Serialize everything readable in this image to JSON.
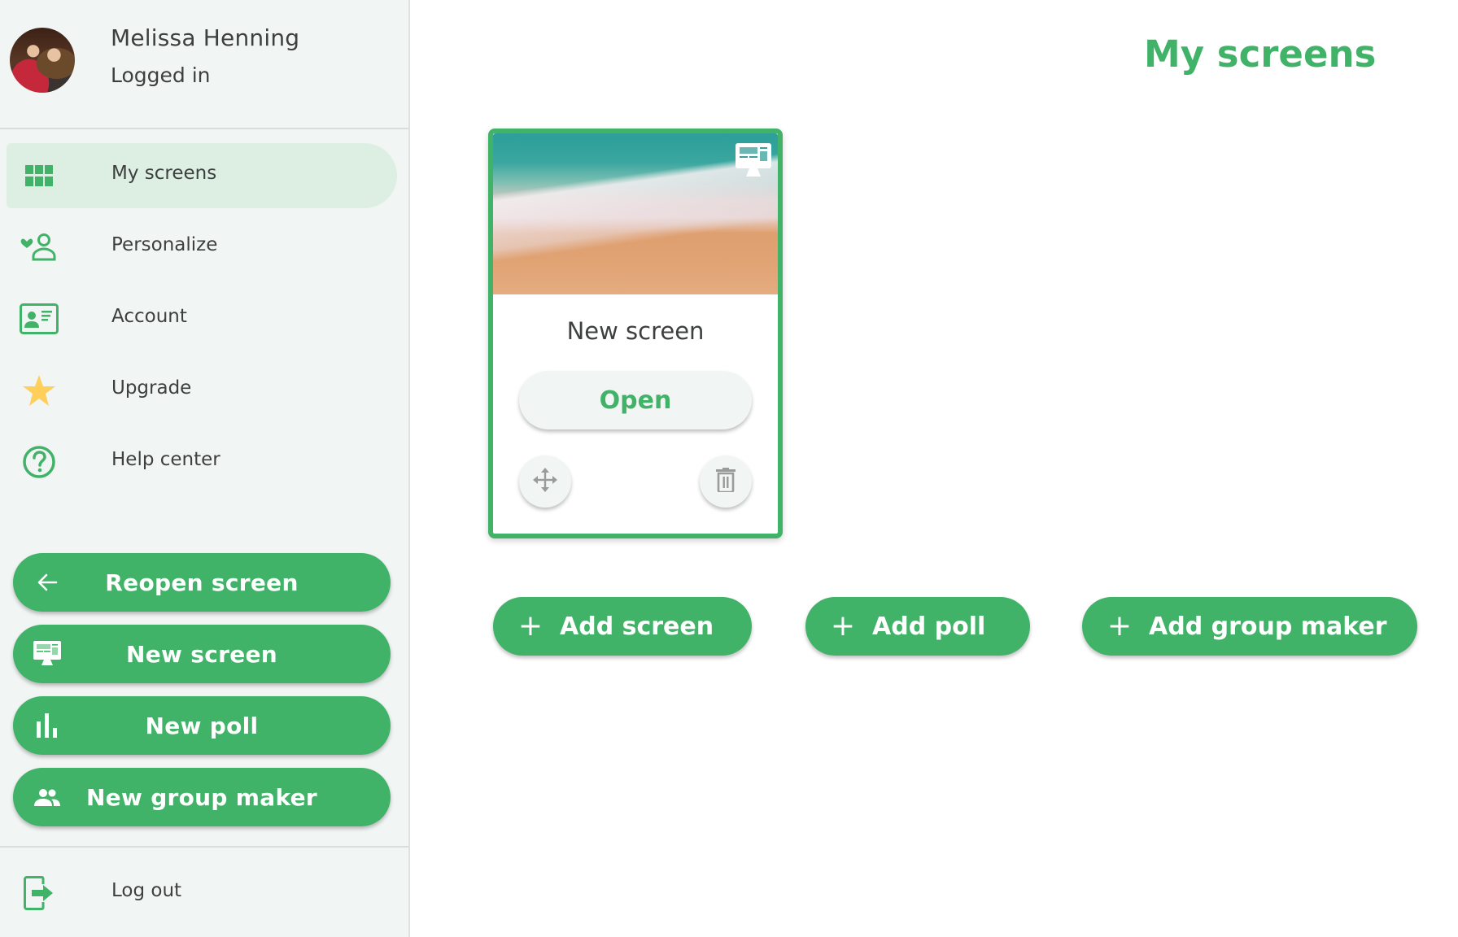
{
  "colors": {
    "accent": "#41b368",
    "sidebar_bg": "#f1f5f4",
    "active_item_bg": "#ddefe3",
    "star": "#ffcf5c",
    "icon_gray": "#9a9a9a"
  },
  "user": {
    "name": "Melissa Henning",
    "status": "Logged in",
    "avatar_icon": "user-avatar-photo"
  },
  "sidebar": {
    "nav": [
      {
        "label": "My screens",
        "icon": "grid-icon",
        "active": true
      },
      {
        "label": "Personalize",
        "icon": "person-heart-icon",
        "active": false
      },
      {
        "label": "Account",
        "icon": "id-card-icon",
        "active": false
      },
      {
        "label": "Upgrade",
        "icon": "star-icon",
        "active": false
      },
      {
        "label": "Help center",
        "icon": "help-circle-icon",
        "active": false
      }
    ],
    "actions": [
      {
        "label": "Reopen screen",
        "icon": "arrow-left-icon"
      },
      {
        "label": "New screen",
        "icon": "monitor-icon"
      },
      {
        "label": "New poll",
        "icon": "bar-chart-icon"
      },
      {
        "label": "New group maker",
        "icon": "people-icon"
      }
    ],
    "logout": {
      "label": "Log out",
      "icon": "logout-icon"
    }
  },
  "main": {
    "title": "My screens",
    "cards": [
      {
        "title": "New screen",
        "thumbnail": "beach-aerial-image",
        "badge_icon": "monitor-icon",
        "open_label": "Open",
        "move_icon": "move-arrows-icon",
        "delete_icon": "trash-icon"
      }
    ],
    "add_buttons": [
      {
        "label": "Add screen",
        "icon": "plus-icon"
      },
      {
        "label": "Add poll",
        "icon": "plus-icon"
      },
      {
        "label": "Add group maker",
        "icon": "plus-icon"
      }
    ]
  }
}
